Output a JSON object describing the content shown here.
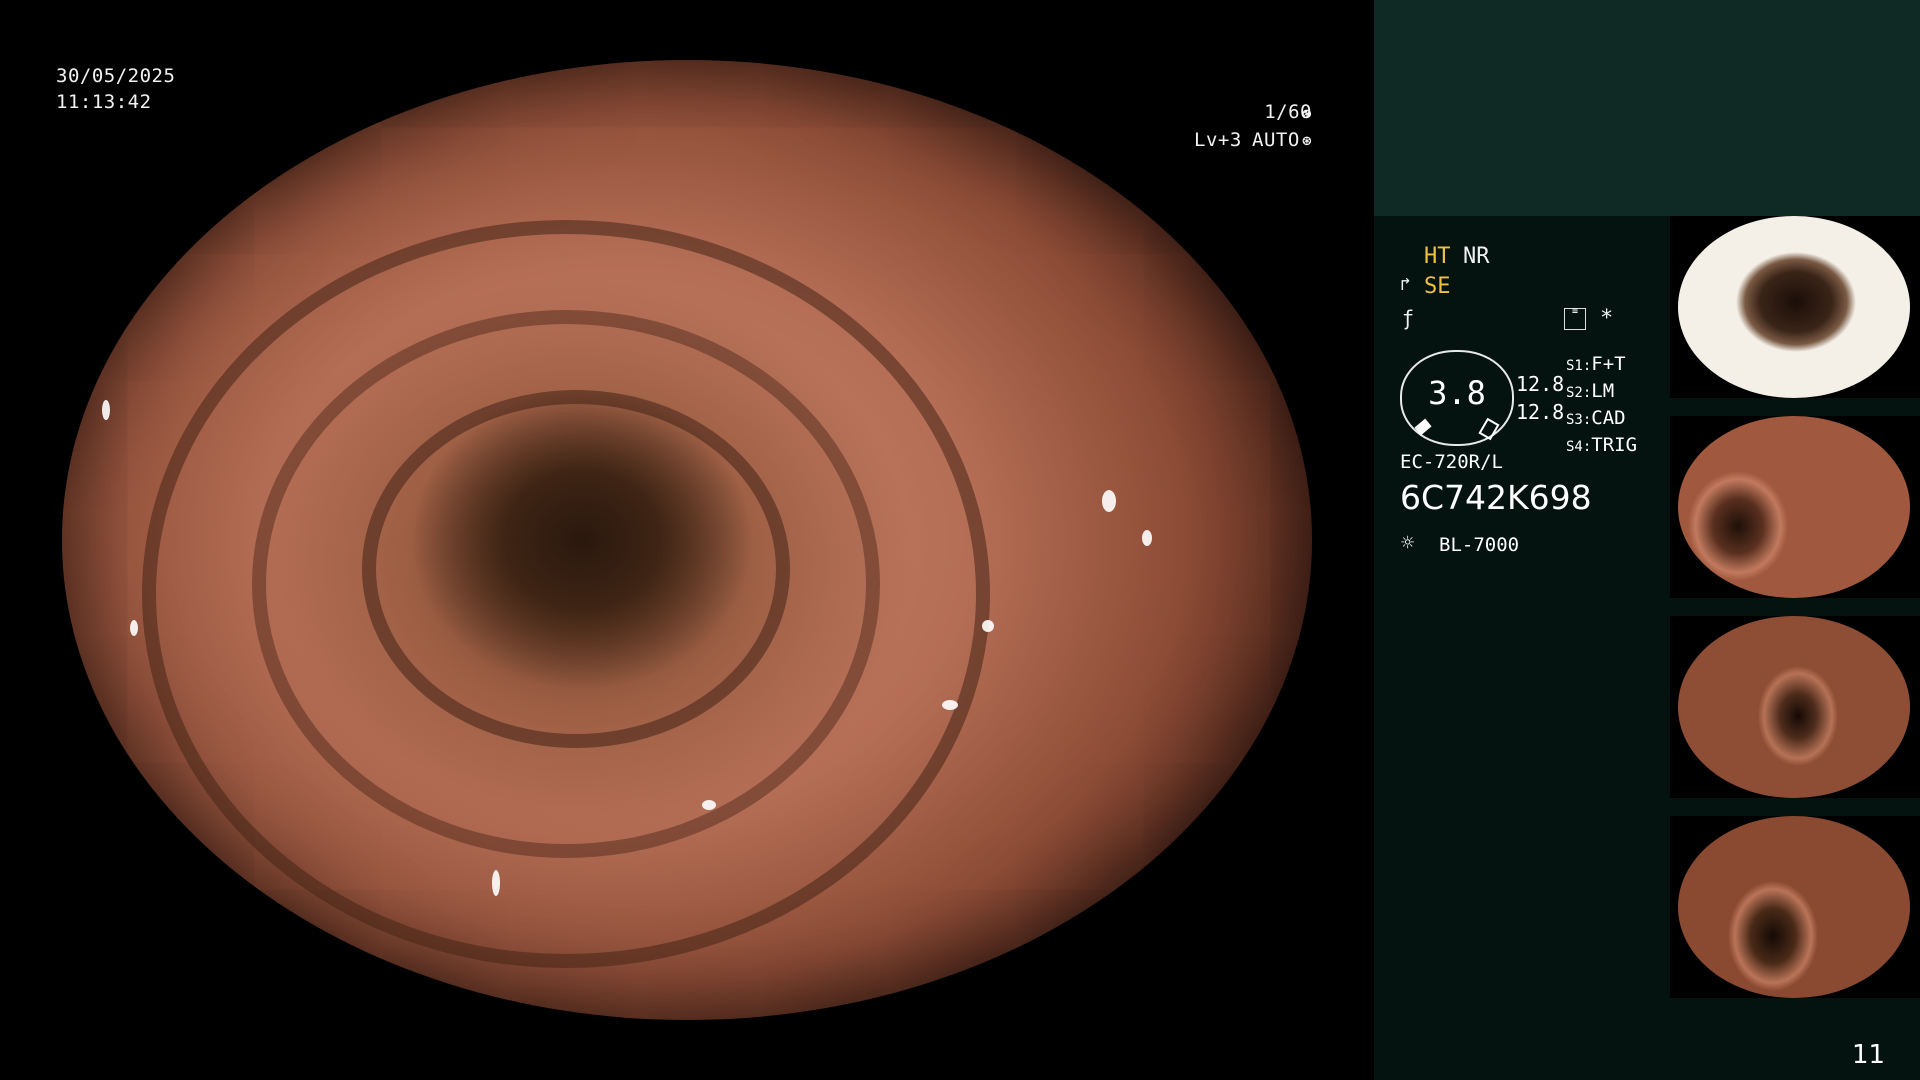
{
  "overlay": {
    "date": "30/05/2025",
    "time": "11:13:42",
    "shutter": "1/60",
    "level": "Lv+3",
    "iris": "AUTO"
  },
  "panel": {
    "modes": {
      "ht": "HT",
      "nr": "NR",
      "se": "SE"
    },
    "star": "*",
    "gauge_value": "3.8",
    "gauge_right_1": "12.8",
    "gauge_right_2": "12.8",
    "switches": [
      {
        "key": "S1:",
        "value": "F+T"
      },
      {
        "key": "S2:",
        "value": "LM"
      },
      {
        "key": "S3:",
        "value": "CAD"
      },
      {
        "key": "S4:",
        "value": "TRIG"
      }
    ],
    "scope_model": "EC-720R/L",
    "scope_serial": "6C742K698",
    "light_source": "BL-7000"
  },
  "thumbnails": [
    {
      "name": "thumbnail-1"
    },
    {
      "name": "thumbnail-2"
    },
    {
      "name": "thumbnail-3"
    },
    {
      "name": "thumbnail-4"
    }
  ],
  "page_number": "11",
  "colors": {
    "accent_yellow": "#f0c040",
    "panel_bg": "#051310",
    "panel_top_bg": "#0f2a25"
  }
}
